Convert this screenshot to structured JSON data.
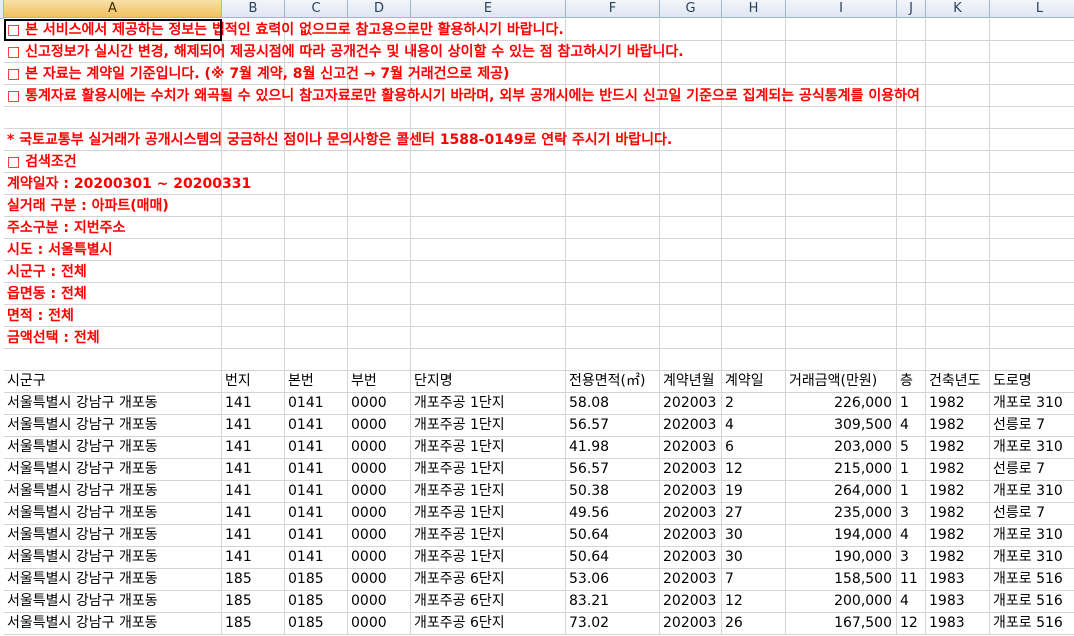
{
  "columns": [
    "A",
    "B",
    "C",
    "D",
    "E",
    "F",
    "G",
    "H",
    "I",
    "J",
    "K",
    "L"
  ],
  "selected_column": "A",
  "notes": [
    "□ 본 서비스에서 제공하는 정보는 법적인 효력이 없으므로 참고용으로만 활용하시기 바랍니다.",
    "□ 신고정보가 실시간 변경, 해제되어 제공시점에 따라 공개건수 및 내용이 상이할 수 있는 점 참고하시기 바랍니다.",
    "□ 본 자료는 계약일 기준입니다. (※ 7월 계약, 8월 신고건 → 7월 거래건으로 제공)",
    "□ 통계자료 활용시에는 수치가 왜곡될 수 있으니 참고자료로만 활용하시기 바라며, 외부 공개시에는 반드시 신고일 기준으로 집계되는 공식통계를 이용하여",
    "",
    "* 국토교통부 실거래가 공개시스템의 궁금하신 점이나 문의사항은 콜센터 1588-0149로 연락 주시기 바랍니다.",
    "□ 검색조건",
    "계약일자 : 20200301 ~ 20200331",
    "실거래 구분 : 아파트(매매)",
    "주소구분 : 지번주소",
    "시도 : 서울특별시",
    "시군구 : 전체",
    "읍면동 : 전체",
    "면적 : 전체",
    "금액선택 : 전체",
    ""
  ],
  "table": {
    "headers": [
      "시군구",
      "번지",
      "본번",
      "부번",
      "단지명",
      "전용면적(㎡)",
      "계약년월",
      "계약일",
      "거래금액(만원)",
      "층",
      "건축년도",
      "도로명"
    ],
    "rows": [
      [
        "서울특별시 강남구 개포동",
        "141",
        "0141",
        "0000",
        "개포주공 1단지",
        "58.08",
        "202003",
        "2",
        "226,000",
        "1",
        "1982",
        "개포로 310"
      ],
      [
        "서울특별시 강남구 개포동",
        "141",
        "0141",
        "0000",
        "개포주공 1단지",
        "56.57",
        "202003",
        "4",
        "309,500",
        "4",
        "1982",
        "선릉로 7"
      ],
      [
        "서울특별시 강남구 개포동",
        "141",
        "0141",
        "0000",
        "개포주공 1단지",
        "41.98",
        "202003",
        "6",
        "203,000",
        "5",
        "1982",
        "개포로 310"
      ],
      [
        "서울특별시 강남구 개포동",
        "141",
        "0141",
        "0000",
        "개포주공 1단지",
        "56.57",
        "202003",
        "12",
        "215,000",
        "1",
        "1982",
        "선릉로 7"
      ],
      [
        "서울특별시 강남구 개포동",
        "141",
        "0141",
        "0000",
        "개포주공 1단지",
        "50.38",
        "202003",
        "19",
        "264,000",
        "1",
        "1982",
        "개포로 310"
      ],
      [
        "서울특별시 강남구 개포동",
        "141",
        "0141",
        "0000",
        "개포주공 1단지",
        "49.56",
        "202003",
        "27",
        "235,000",
        "3",
        "1982",
        "선릉로 7"
      ],
      [
        "서울특별시 강남구 개포동",
        "141",
        "0141",
        "0000",
        "개포주공 1단지",
        "50.64",
        "202003",
        "30",
        "194,000",
        "4",
        "1982",
        "개포로 310"
      ],
      [
        "서울특별시 강남구 개포동",
        "141",
        "0141",
        "0000",
        "개포주공 1단지",
        "50.64",
        "202003",
        "30",
        "190,000",
        "3",
        "1982",
        "개포로 310"
      ],
      [
        "서울특별시 강남구 개포동",
        "185",
        "0185",
        "0000",
        "개포주공 6단지",
        "53.06",
        "202003",
        "7",
        "158,500",
        "11",
        "1983",
        "개포로 516"
      ],
      [
        "서울특별시 강남구 개포동",
        "185",
        "0185",
        "0000",
        "개포주공 6단지",
        "83.21",
        "202003",
        "12",
        "200,000",
        "4",
        "1983",
        "개포로 516"
      ],
      [
        "서울특별시 강남구 개포동",
        "185",
        "0185",
        "0000",
        "개포주공 6단지",
        "73.02",
        "202003",
        "26",
        "167,500",
        "12",
        "1983",
        "개포로 516"
      ]
    ]
  }
}
